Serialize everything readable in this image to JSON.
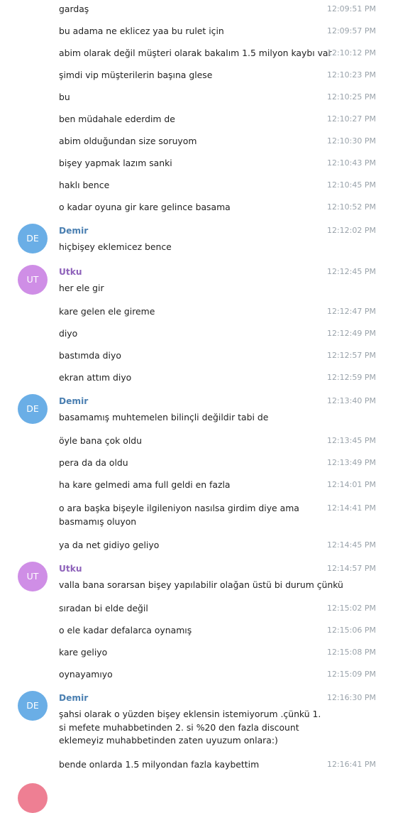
{
  "colors": {
    "demir_name": "#4a7fb1",
    "demir_avatar": "#6aaee6",
    "utku_name": "#8e62ba",
    "utku_avatar": "#cf8ee6",
    "timestamp": "#9aa3ab",
    "next_avatar": "#ee7f93"
  },
  "senders": {
    "demir": {
      "name": "Demir",
      "initials": "DE"
    },
    "utku": {
      "name": "Utku",
      "initials": "UT"
    }
  },
  "messages": [
    {
      "text": "gardaş",
      "time": "12:09:51 PM"
    },
    {
      "text": "bu adama ne eklicez yaa bu rulet için",
      "time": "12:09:57 PM"
    },
    {
      "text": "abim olarak değil müşteri olarak bakalım 1.5 milyon kaybı var",
      "time": "12:10:12 PM"
    },
    {
      "text": "şimdi vip müşterilerin başına glese",
      "time": "12:10:23 PM"
    },
    {
      "text": "bu",
      "time": "12:10:25 PM"
    },
    {
      "text": "ben müdahale ederdim de",
      "time": "12:10:27 PM"
    },
    {
      "text": "abim olduğundan size soruyom",
      "time": "12:10:30 PM"
    },
    {
      "text": "bişey yapmak lazım sanki",
      "time": "12:10:43 PM"
    },
    {
      "text": "haklı bence",
      "time": "12:10:45 PM"
    },
    {
      "text": "o kadar oyuna gir kare gelince basama",
      "time": "12:10:52 PM"
    },
    {
      "text": "hiçbişey eklemicez bence",
      "time": "12:12:02 PM"
    },
    {
      "text": "her ele gir",
      "time": "12:12:45 PM"
    },
    {
      "text": "kare gelen ele gireme",
      "time": "12:12:47 PM"
    },
    {
      "text": "diyo",
      "time": "12:12:49 PM"
    },
    {
      "text": "bastımda diyo",
      "time": "12:12:57 PM"
    },
    {
      "text": "ekran attım diyo",
      "time": "12:12:59 PM"
    },
    {
      "text": "basamamış muhtemelen bilinçli değildir tabi de",
      "time": "12:13:40 PM"
    },
    {
      "text": "öyle bana çok oldu",
      "time": "12:13:45 PM"
    },
    {
      "text": "pera da da oldu",
      "time": "12:13:49 PM"
    },
    {
      "text": "ha kare gelmedi ama full geldi en fazla",
      "time": "12:14:01 PM"
    },
    {
      "text": "o ara başka bişeyle ilgileniyon nasılsa girdim diye ama basmamış oluyon",
      "time": "12:14:41 PM"
    },
    {
      "text": "ya da net gidiyo geliyo",
      "time": "12:14:45 PM"
    },
    {
      "text": "valla bana sorarsan bişey yapılabilir olağan üstü bi durum çünkü",
      "time": "12:14:57 PM"
    },
    {
      "text": "sıradan bi elde değil",
      "time": "12:15:02 PM"
    },
    {
      "text": "o ele kadar defalarca oynamış",
      "time": "12:15:06 PM"
    },
    {
      "text": "kare geliyo",
      "time": "12:15:08 PM"
    },
    {
      "text": "oynayamıyo",
      "time": "12:15:09 PM"
    },
    {
      "text": "şahsi olarak o yüzden bişey eklensin istemiyorum .çünkü 1. si mefete muhabbetinden 2. si %20 den fazla discount eklemeyiz muhabbetinden zaten uyuzum onlara:)",
      "time": "12:16:30 PM"
    },
    {
      "text": "bende onlarda 1.5 milyondan fazla kaybettim",
      "time": "12:16:41 PM"
    }
  ]
}
